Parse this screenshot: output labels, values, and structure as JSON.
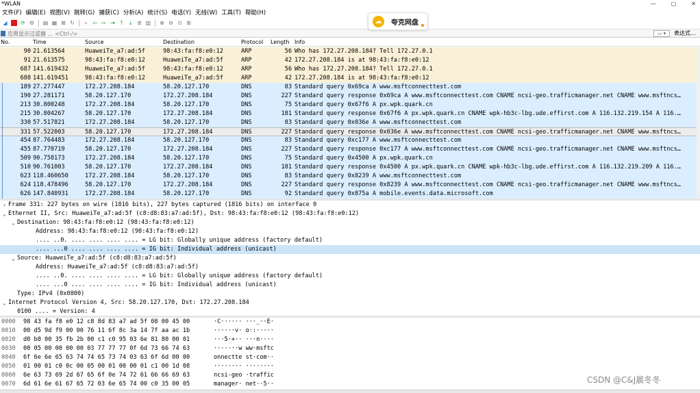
{
  "window": {
    "title": "*WLAN",
    "min_icon": "minimize-icon",
    "max_icon": "restore-icon",
    "close_icon": "close-icon",
    "min_glyph": "—",
    "max_glyph": "▢",
    "close_glyph": "✕"
  },
  "menu": [
    "文件(F)",
    "编辑(E)",
    "视图(V)",
    "跳转(G)",
    "捕获(C)",
    "分析(A)",
    "统计(S)",
    "电话(Y)",
    "无线(W)",
    "工具(T)",
    "帮助(H)"
  ],
  "toolbar": {
    "icons": [
      "shark-fin-icon",
      "stop-icon",
      "restart-icon",
      "options-icon",
      "open-icon",
      "save-icon",
      "close-file-icon",
      "reload-icon",
      "find-icon",
      "back-icon",
      "forward-icon",
      "goto-icon",
      "first-icon",
      "last-icon",
      "autoscroll-icon",
      "colorize-icon",
      "zoom-in-icon",
      "zoom-out-icon",
      "zoom-reset-icon",
      "resize-columns-icon"
    ]
  },
  "popup": {
    "label": "夸克网盘",
    "icon": "cloud-icon"
  },
  "filter": {
    "placeholder": "应用显示过滤器 … <Ctrl-/>",
    "expression_label": "表达式…"
  },
  "columns": {
    "no": "No.",
    "time": "Time",
    "source": "Source",
    "destination": "Destination",
    "protocol": "Protocol",
    "length": "Length",
    "info": "Info"
  },
  "packets": [
    {
      "no": "90",
      "time": "21.613564",
      "src": "HuaweiTe_a7:ad:5f",
      "dst": "98:43:fa:f8:e0:12",
      "proto": "ARP",
      "len": "56",
      "info": "Who has 172.27.208.184? Tell 172.27.0.1",
      "kind": "arp"
    },
    {
      "no": "91",
      "time": "21.613575",
      "src": "98:43:fa:f8:e0:12",
      "dst": "HuaweiTe_a7:ad:5f",
      "proto": "ARP",
      "len": "42",
      "info": "172.27.208.184 is at 98:43:fa:f8:e0:12",
      "kind": "arp"
    },
    {
      "no": "687",
      "time": "141.619432",
      "src": "HuaweiTe_a7:ad:5f",
      "dst": "98:43:fa:f8:e0:12",
      "proto": "ARP",
      "len": "56",
      "info": "Who has 172.27.208.184? Tell 172.27.0.1",
      "kind": "arp"
    },
    {
      "no": "688",
      "time": "141.619451",
      "src": "98:43:fa:f8:e0:12",
      "dst": "HuaweiTe_a7:ad:5f",
      "proto": "ARP",
      "len": "42",
      "info": "172.27.208.184 is at 98:43:fa:f8:e0:12",
      "kind": "arp"
    },
    {
      "no": "189",
      "time": "27.277447",
      "src": "172.27.208.184",
      "dst": "58.20.127.170",
      "proto": "DNS",
      "len": "83",
      "info": "Standard query 0x69ca A www.msftconnecttest.com",
      "kind": "dns"
    },
    {
      "no": "190",
      "time": "27.281171",
      "src": "58.20.127.170",
      "dst": "172.27.208.184",
      "proto": "DNS",
      "len": "227",
      "info": "Standard query response 0x69ca A www.msftconnecttest.com CNAME ncsi-geo.trafficmanager.net CNAME www.msftncs…",
      "kind": "dns"
    },
    {
      "no": "213",
      "time": "30.800248",
      "src": "172.27.208.184",
      "dst": "58.20.127.170",
      "proto": "DNS",
      "len": "75",
      "info": "Standard query 0x67f6 A px.wpk.quark.cn",
      "kind": "dns"
    },
    {
      "no": "215",
      "time": "30.804267",
      "src": "58.20.127.170",
      "dst": "172.27.208.184",
      "proto": "DNS",
      "len": "181",
      "info": "Standard query response 0x67f6 A px.wpk.quark.cn CNAME wpk-hb3c-lbg.ude.effirst.com A 116.132.219.154 A 116.…",
      "kind": "dns"
    },
    {
      "no": "330",
      "time": "57.517821",
      "src": "172.27.208.184",
      "dst": "58.20.127.170",
      "proto": "DNS",
      "len": "83",
      "info": "Standard query 0x036e A www.msftconnecttest.com",
      "kind": "dns"
    },
    {
      "no": "331",
      "time": "57.522003",
      "src": "58.20.127.170",
      "dst": "172.27.208.184",
      "proto": "DNS",
      "len": "227",
      "info": "Standard query response 0x036e A www.msftconnecttest.com CNAME ncsi-geo.trafficmanager.net CNAME www.msftncs…",
      "kind": "selected"
    },
    {
      "no": "454",
      "time": "87.764483",
      "src": "172.27.208.184",
      "dst": "58.20.127.170",
      "proto": "DNS",
      "len": "83",
      "info": "Standard query 0xc177 A www.msftconnecttest.com",
      "kind": "dns"
    },
    {
      "no": "455",
      "time": "87.770719",
      "src": "58.20.127.170",
      "dst": "172.27.208.184",
      "proto": "DNS",
      "len": "227",
      "info": "Standard query response 0xc177 A www.msftconnecttest.com CNAME ncsi-geo.trafficmanager.net CNAME www.msftncs…",
      "kind": "dns"
    },
    {
      "no": "509",
      "time": "90.758173",
      "src": "172.27.208.184",
      "dst": "58.20.127.170",
      "proto": "DNS",
      "len": "75",
      "info": "Standard query 0x4500 A px.wpk.quark.cn",
      "kind": "dns"
    },
    {
      "no": "510",
      "time": "90.761003",
      "src": "58.20.127.170",
      "dst": "172.27.208.184",
      "proto": "DNS",
      "len": "181",
      "info": "Standard query response 0x4500 A px.wpk.quark.cn CNAME wpk-hb3c-lbg.ude.effirst.com A 116.132.219.209 A 116.…",
      "kind": "dns"
    },
    {
      "no": "623",
      "time": "118.460650",
      "src": "172.27.208.184",
      "dst": "58.20.127.170",
      "proto": "DNS",
      "len": "83",
      "info": "Standard query 0x8239 A www.msftconnecttest.com",
      "kind": "dns"
    },
    {
      "no": "624",
      "time": "118.478496",
      "src": "58.20.127.170",
      "dst": "172.27.208.184",
      "proto": "DNS",
      "len": "227",
      "info": "Standard query response 0x8239 A www.msftconnecttest.com CNAME ncsi-geo.trafficmanager.net CNAME www.msftncs…",
      "kind": "dns"
    },
    {
      "no": "626",
      "time": "147.840931",
      "src": "172.27.208.184",
      "dst": "58.20.127.170",
      "proto": "DNS",
      "len": "92",
      "info": "Standard query 0x875a A mobile.events.data.microsoft.com",
      "kind": "dns"
    }
  ],
  "details": [
    {
      "indent": 0,
      "arrow": "›",
      "text": "Frame 331: 227 bytes on wire (1816 bits), 227 bytes captured (1816 bits) on interface 0",
      "hl": false
    },
    {
      "indent": 0,
      "arrow": "⌄",
      "text": "Ethernet II, Src: HuaweiTe_a7:ad:5f (c8:d8:83:a7:ad:5f), Dst: 98:43:fa:f8:e0:12 (98:43:fa:f8:e0:12)",
      "hl": false
    },
    {
      "indent": 1,
      "arrow": "⌄",
      "text": "Destination: 98:43:fa:f8:e0:12 (98:43:fa:f8:e0:12)",
      "hl": false
    },
    {
      "indent": 2,
      "arrow": "",
      "text": "Address: 98:43:fa:f8:e0:12 (98:43:fa:f8:e0:12)",
      "hl": false
    },
    {
      "indent": 2,
      "arrow": "",
      "text": ".... ..0. .... .... .... .... = LG bit: Globally unique address (factory default)",
      "hl": false
    },
    {
      "indent": 2,
      "arrow": "",
      "text": ".... ...0 .... .... .... .... = IG bit: Individual address (unicast)",
      "hl": true
    },
    {
      "indent": 1,
      "arrow": "⌄",
      "text": "Source: HuaweiTe_a7:ad:5f (c8:d8:83:a7:ad:5f)",
      "hl": false
    },
    {
      "indent": 2,
      "arrow": "",
      "text": "Address: HuaweiTe_a7:ad:5f (c8:d8:83:a7:ad:5f)",
      "hl": false
    },
    {
      "indent": 2,
      "arrow": "",
      "text": ".... ..0. .... .... .... .... = LG bit: Globally unique address (factory default)",
      "hl": false
    },
    {
      "indent": 2,
      "arrow": "",
      "text": ".... ...0 .... .... .... .... = IG bit: Individual address (unicast)",
      "hl": false
    },
    {
      "indent": 1,
      "arrow": "",
      "text": "Type: IPv4 (0x0800)",
      "hl": false
    },
    {
      "indent": 0,
      "arrow": "⌄",
      "text": "Internet Protocol Version 4, Src: 58.20.127.170, Dst: 172.27.208.184",
      "hl": false
    },
    {
      "indent": 1,
      "arrow": "",
      "text": "0100 .... = Version: 4",
      "hl": false
    }
  ],
  "hex": [
    {
      "off": "0000",
      "bytes": "98 43 fa f8 e0 12 c8 8d  83 a7 ad 5f 08 00 45 00",
      "ascii": "·C······ ···_··E·"
    },
    {
      "off": "0010",
      "bytes": "00 d5 9d f9 00 00 76 11  6f 8c 3a 14 7f aa ac 1b",
      "ascii": "······v· o·:·····"
    },
    {
      "off": "0020",
      "bytes": "d0 b8 00 35 fb 2b 00 c1  c0 95 03 6e 81 80 00 01",
      "ascii": "···5·+·· ···n····"
    },
    {
      "off": "0030",
      "bytes": "00 05 00 00 00 00 03 77  77 77 0f 6d 73 66 74 63",
      "ascii": "·······w ww·msftc"
    },
    {
      "off": "0040",
      "bytes": "6f 6e 6e 65 63 74 74 65  73 74 03 63 6f 6d 00 00",
      "ascii": "onnectte st·com··"
    },
    {
      "off": "0050",
      "bytes": "01 00 01 c0 0c 00 05 00  01 00 00 01 c1 00 1d 08",
      "ascii": "········ ········"
    },
    {
      "off": "0060",
      "bytes": "6e 63 73 69 2d 67 65 6f  0e 74 72 61 66 66 69 63",
      "ascii": "ncsi-geo ·traffic"
    },
    {
      "off": "0070",
      "bytes": "6d 61 6e 61 67 65 72 03  6e 65 74 00 c0 35 00 05",
      "ascii": "manager· net··5··"
    }
  ],
  "watermark": "CSDN @C&J晨冬冬",
  "colors": {
    "arp_row": "#faf0d7",
    "dns_row": "#daeeff",
    "selected_row": "#ececec",
    "highlight_detail": "#cce4f7",
    "accent": "#2a7de1"
  }
}
